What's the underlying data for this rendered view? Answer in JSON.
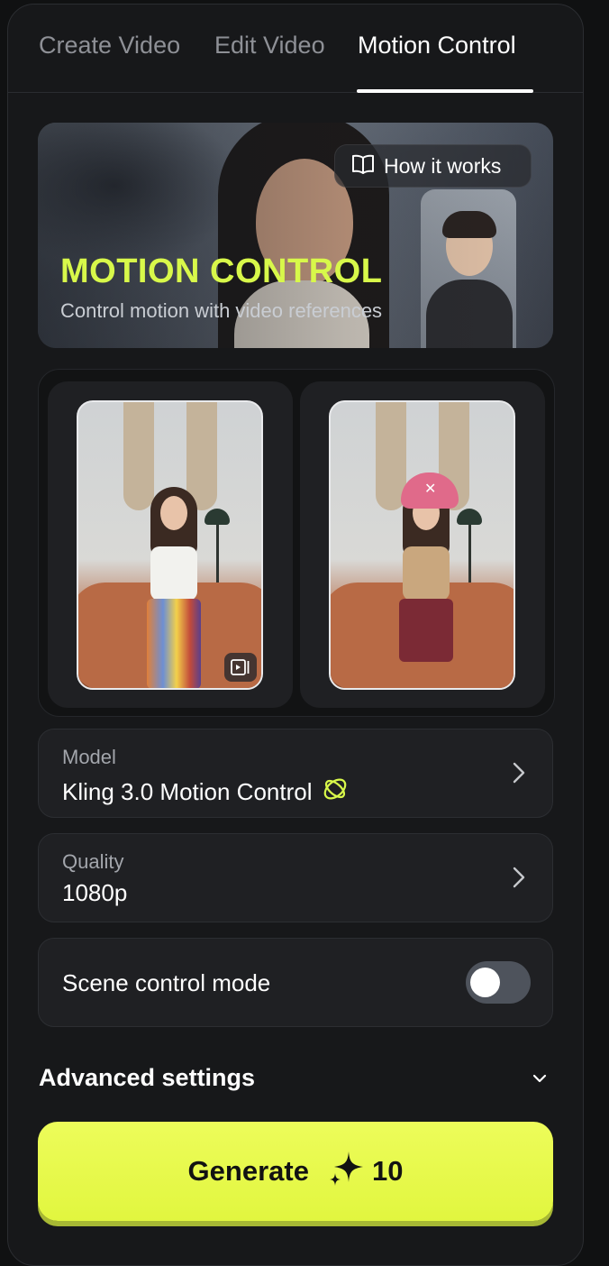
{
  "tabs": [
    {
      "label": "Create Video",
      "active": false
    },
    {
      "label": "Edit Video",
      "active": false
    },
    {
      "label": "Motion Control",
      "active": true
    }
  ],
  "hero": {
    "title": "MOTION CONTROL",
    "subtitle": "Control motion with video references",
    "how_it_works_label": "How it works",
    "title_color": "#d8f84a"
  },
  "references": {
    "motion_reference_icon": "video-frame-icon",
    "character_reference_icon": "image"
  },
  "settings": {
    "model": {
      "label": "Model",
      "value": "Kling 3.0 Motion Control",
      "badge_icon": "kling-logo-icon"
    },
    "quality": {
      "label": "Quality",
      "value": "1080p"
    },
    "scene_control": {
      "label": "Scene control mode",
      "enabled": false
    }
  },
  "advanced": {
    "label": "Advanced settings",
    "expanded": false
  },
  "generate": {
    "label": "Generate",
    "cost": "10",
    "cost_icon": "sparkle-icon",
    "color": "#e1f63f"
  },
  "colors": {
    "accent": "#d8f84a",
    "panel_bg": "#17181a",
    "card_bg": "#1f2023"
  }
}
